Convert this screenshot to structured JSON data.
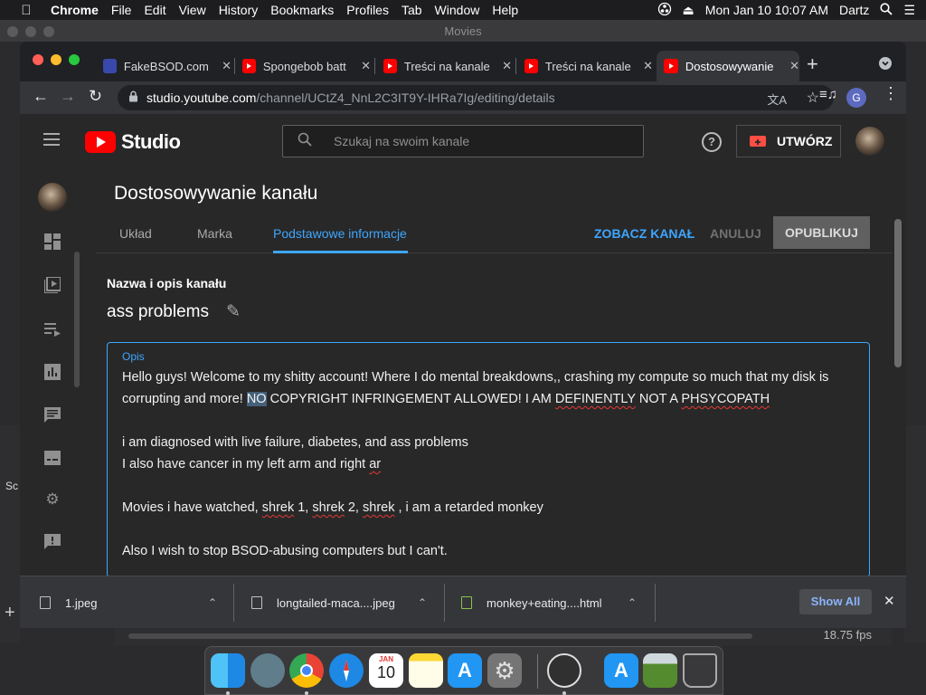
{
  "menubar": {
    "items": [
      "Chrome",
      "File",
      "Edit",
      "View",
      "History",
      "Bookmarks",
      "Profiles",
      "Tab",
      "Window",
      "Help"
    ],
    "datetime": "Mon Jan 10  10:07 AM",
    "user": "Dartz"
  },
  "background_window": {
    "title": "Movies",
    "left_label": "Sc",
    "fps": "18.75 fps"
  },
  "tabs": [
    {
      "title": "FakeBSOD.com",
      "favicon_color": "#3949ab"
    },
    {
      "title": "Spongebob batt",
      "favicon_color": "#ff0000"
    },
    {
      "title": "Treści na kanale",
      "favicon_color": "#ff0000"
    },
    {
      "title": "Treści na kanale",
      "favicon_color": "#ff0000"
    },
    {
      "title": "Dostosowywanie",
      "favicon_color": "#ff0000",
      "active": true
    }
  ],
  "omnibox": {
    "host": "studio.youtube.com",
    "path": "/channel/UCtZ4_NnL2C3IT9Y-IHRa7Ig/editing/details"
  },
  "profile_initial": "G",
  "studio": {
    "logo_text": "Studio",
    "search_placeholder": "Szukaj na swoim kanale",
    "create_label": "UTWÓRZ",
    "page_title": "Dostosowywanie kanału",
    "tabs": [
      "Układ",
      "Marka",
      "Podstawowe informacje"
    ],
    "active_tab": "Podstawowe informacje",
    "view_channel": "ZOBACZ KANAŁ",
    "cancel": "ANULUJ",
    "publish": "OPUBLIKUJ",
    "section_label": "Nazwa i opis kanału",
    "channel_name": "ass problems",
    "description_label": "Opis",
    "description_lines": {
      "l1": "Hello guys! Welcome to my shitty account! Where I do mental breakdowns,, crashing my compute so much that my disk is",
      "l2a": "corrupting and more! ",
      "l2b": "NO",
      "l2c": " COPYRIGHT INFRINGEMENT ALLOWED! I AM ",
      "l2d": "DEFINENTLY",
      "l2e": " NOT A  ",
      "l2f": "PHSYCOPATH",
      "l3": "i am diagnosed with live failure, diabetes, and ass problems",
      "l4a": "I also have cancer in my left arm and right ",
      "l4b": "ar",
      "l5a": "Movies i have watched, ",
      "l5b": "shrek",
      "l5c": " 1, ",
      "l5d": "shrek",
      "l5e": " 2, ",
      "l5f": "shrek",
      "l5g": " , i am a retarded monkey",
      "l6": "Also I wish to stop BSOD-abusing computers but I can't."
    },
    "sidebar_icons": [
      "dashboard-icon",
      "content-icon",
      "playlists-icon",
      "analytics-icon",
      "comments-icon",
      "subtitles-icon",
      "settings-icon",
      "feedback-icon"
    ]
  },
  "downloads": [
    {
      "name": "1.jpeg"
    },
    {
      "name": "longtailed-maca....jpeg"
    },
    {
      "name": "monkey+eating....html"
    }
  ],
  "show_all": "Show All",
  "colors": {
    "youtube_red": "#ff0000",
    "studio_blue": "#3ea6ff",
    "page_bg": "#282828"
  },
  "dock": {
    "icons": [
      "finder-icon",
      "launchpad-icon",
      "chrome-icon",
      "safari-icon",
      "calendar-icon",
      "notes-icon",
      "app-store-icon",
      "system-preferences-icon",
      "obs-icon",
      "app-store-icon-2",
      "preview-icon",
      "trash-icon"
    ],
    "calendar_month": "JAN",
    "calendar_day": "10"
  }
}
